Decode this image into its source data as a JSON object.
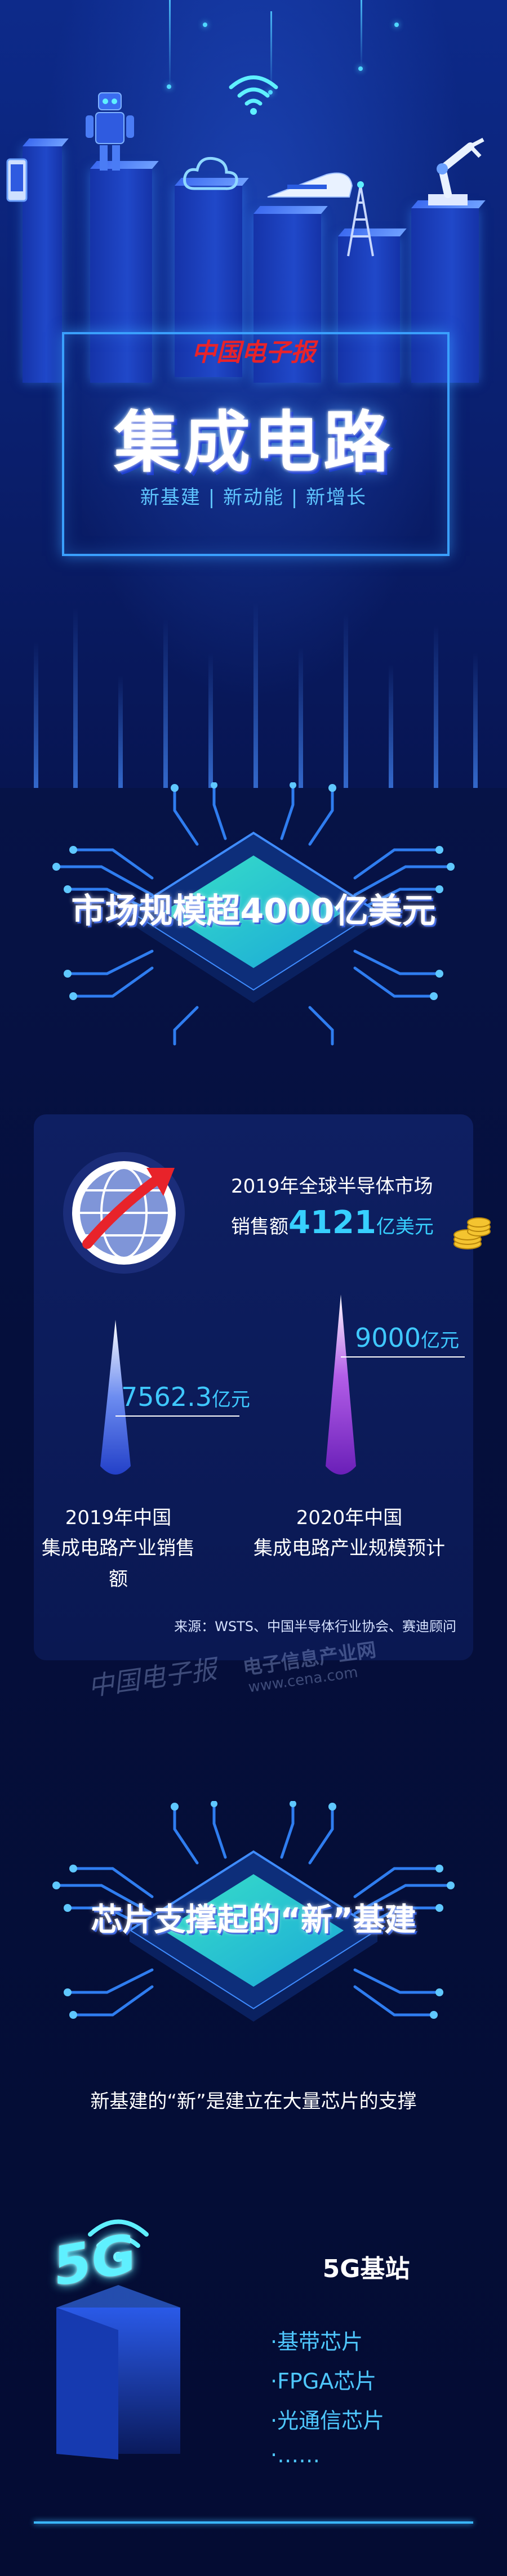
{
  "hero": {
    "logo_text": "中国电子报",
    "title": "集成电路",
    "subtitle": "新基建 | 新动能 | 新增长"
  },
  "market": {
    "banner": "市场规模超4000亿美元"
  },
  "stats": {
    "global_line1": "2019年全球半导体市场",
    "global_prefix": "销售额",
    "global_value": "4121",
    "global_unit": "亿美元",
    "china_2019_value": "7562.3",
    "china_2019_unit": "亿元",
    "china_2019_label_1": "2019年中国",
    "china_2019_label_2": "集成电路产业销售额",
    "china_2020_value": "9000",
    "china_2020_unit": "亿元",
    "china_2020_label_1": "2020年中国",
    "china_2020_label_2": "集成电路产业规模预计",
    "source": "来源：WSTS、中国半导体行业协会、赛迪顾问",
    "watermark_1": "中国电子报",
    "watermark_2": "电子信息产业网",
    "watermark_3": "www.cena.com"
  },
  "infra": {
    "banner": "芯片支撑起的“新”基建",
    "subtitle": "新基建的“新”是建立在大量芯片的支撑"
  },
  "fiveg": {
    "title": "5G基站",
    "items": [
      "·基带芯片",
      "·FPGA芯片",
      "·光通信芯片",
      "·……"
    ],
    "icon_text": "5G"
  },
  "colors": {
    "accent": "#37d0ff",
    "title_shadow": "#1e3fd0",
    "logo_red": "#e8232a"
  }
}
